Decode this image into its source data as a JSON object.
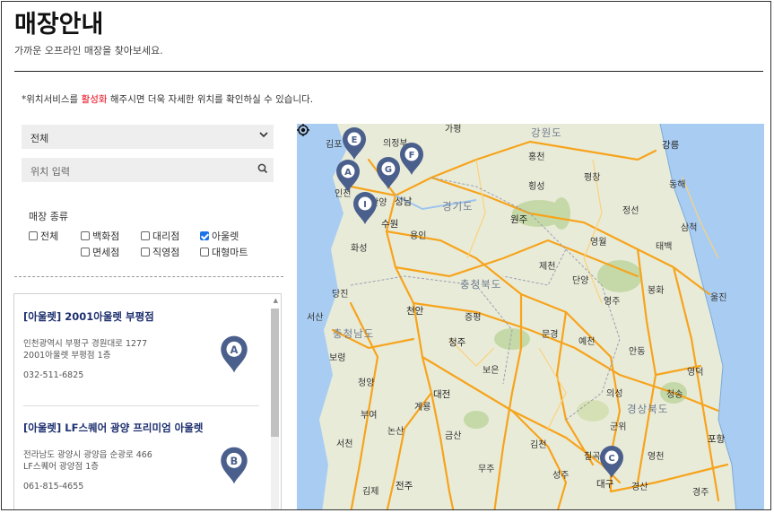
{
  "header": {
    "title": "매장안내",
    "subtitle": "가까운 오프라인 매장을 찾아보세요."
  },
  "notice": {
    "prefix": "*위치서비스를 ",
    "highlight": "활성화",
    "suffix": " 해주시면 더욱 자세한 위치를 확인하실 수 있습니다."
  },
  "filters": {
    "region_select": "전체",
    "location_placeholder": "위치 입력",
    "store_type_label": "매장 종류",
    "types": [
      {
        "label": "전체",
        "checked": false
      },
      {
        "label": "백화점",
        "checked": false
      },
      {
        "label": "대리점",
        "checked": false
      },
      {
        "label": "아울렛",
        "checked": true
      },
      {
        "label": "면세점",
        "checked": false
      },
      {
        "label": "직영점",
        "checked": false
      },
      {
        "label": "대형마트",
        "checked": false
      }
    ]
  },
  "stores": [
    {
      "name": "[아울렛] 2001아울렛 부평점",
      "addr1": "인천광역시 부평구 경원대로 1277",
      "addr2": "2001아울렛 부평점 1층",
      "phone": "032-511-6825",
      "marker": "A"
    },
    {
      "name": "[아울렛] LF스퀘어 광양 프리미엄 아울렛",
      "addr1": "전라남도 광양시 광양읍 순광로 466",
      "addr2": "LF스퀘어 광양점 1층",
      "phone": "061-815-4655",
      "marker": "B"
    }
  ],
  "map": {
    "provinces": [
      "강원도",
      "경기도",
      "충청북도",
      "충청남도",
      "경상북도"
    ],
    "places": [
      "가평",
      "의정부",
      "김포",
      "홍천",
      "강릉",
      "평창",
      "동해",
      "횡성",
      "안양",
      "성남",
      "인천",
      "수원",
      "용인",
      "원주",
      "정선",
      "삼척",
      "화성",
      "영월",
      "태백",
      "제천",
      "단양",
      "당진",
      "봉화",
      "울진",
      "천안",
      "영주",
      "서산",
      "증평",
      "청주",
      "문경",
      "예천",
      "보령",
      "보은",
      "안동",
      "영덕",
      "청양",
      "대전",
      "의성",
      "청송",
      "부여",
      "계룡",
      "군위",
      "논산",
      "금산",
      "김천",
      "포항",
      "서천",
      "영천",
      "칠곡",
      "무주",
      "성주",
      "대구",
      "경산",
      "김제",
      "전주",
      "경주"
    ],
    "markers": [
      "A",
      "C",
      "E",
      "F",
      "G",
      "I"
    ]
  }
}
